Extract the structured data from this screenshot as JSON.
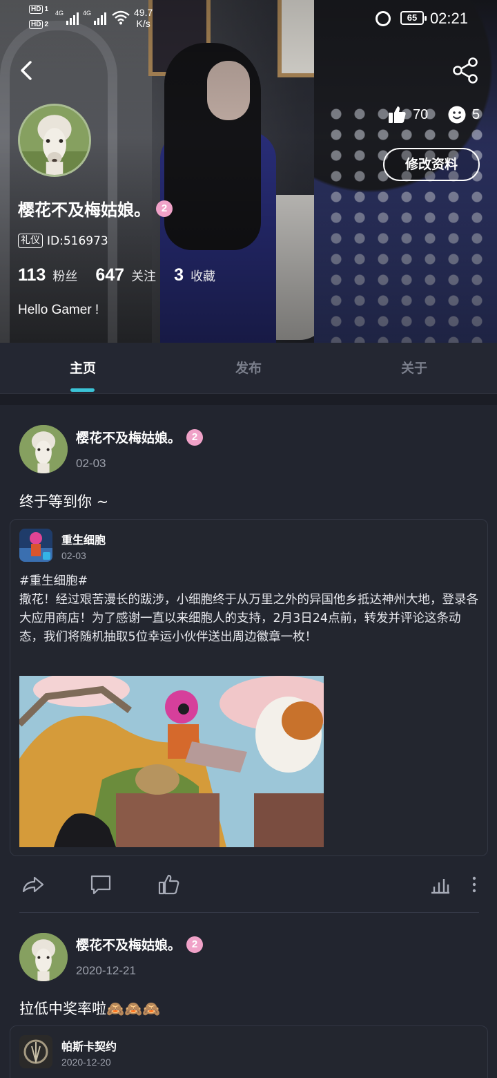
{
  "status_bar": {
    "hd1": "HD",
    "hd1_num": "1",
    "hd2": "HD",
    "hd2_num": "2",
    "net1": "4G",
    "net2": "4G",
    "speed_value": "49.7",
    "speed_unit": "K/s",
    "battery": "65",
    "time": "02:21"
  },
  "profile": {
    "nickname": "樱花不及梅姑娘。",
    "level": "2",
    "tag": "礼仪",
    "id_text": "ID:516973",
    "likes": "70",
    "emoji_count": "5",
    "edit_label": "修改资料",
    "followers_num": "113",
    "followers_label": "粉丝",
    "following_num": "647",
    "following_label": "关注",
    "favorites_num": "3",
    "favorites_label": "收藏",
    "bio": "Hello Gamer !"
  },
  "tabs": [
    {
      "label": "主页",
      "active": true
    },
    {
      "label": "发布",
      "active": false
    },
    {
      "label": "关于",
      "active": false
    }
  ],
  "posts": [
    {
      "author": "樱花不及梅姑娘。",
      "level": "2",
      "date": "02-03",
      "text": "终于等到你 ~",
      "shared": {
        "source_name": "重生细胞",
        "source_date": "02-03",
        "hashtag": "#重生细胞#",
        "body": "撒花！经过艰苦漫长的跋涉，小细胞终于从万里之外的异国他乡抵达神州大地，登录各大应用商店！为了感谢一直以来细胞人的支持，2月3日24点前，转发并评论这条动态，我们将随机抽取5位幸运小伙伴送出周边徽章一枚！"
      }
    },
    {
      "author": "樱花不及梅姑娘。",
      "level": "2",
      "date": "2020-12-21",
      "text": "拉低中奖率啦🙈🙈🙈",
      "shared": {
        "source_name": "帕斯卡契约",
        "source_date": "2020-12-20"
      }
    }
  ],
  "icons": {
    "back": "chevron-left-icon",
    "share": "share-icon",
    "like": "thumbs-up-icon",
    "emoji": "smiley-icon",
    "repost": "repost-icon",
    "comment": "comment-icon",
    "stats": "stats-icon",
    "more": "more-vertical-icon"
  },
  "colors": {
    "accent": "#3bc3d6",
    "background": "#22252f",
    "level_badge": "#f0a2c8"
  }
}
